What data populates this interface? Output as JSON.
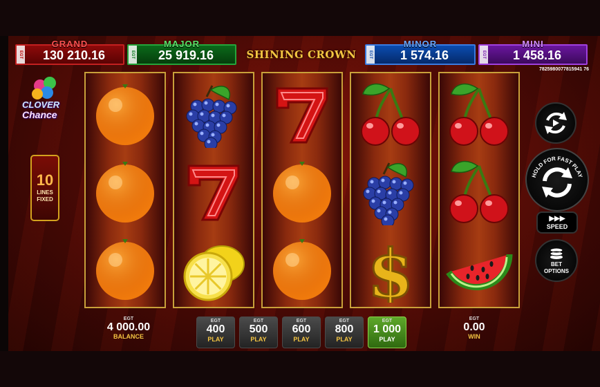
{
  "jackpots": {
    "grand": {
      "name": "GRAND",
      "value": "130 210.16"
    },
    "major": {
      "name": "MAJOR",
      "value": "25 919.16"
    },
    "minor": {
      "name": "MINOR",
      "value": "1 574.16"
    },
    "mini": {
      "name": "MINI",
      "value": "1 458.16"
    },
    "provider": "EGT"
  },
  "game_title": "SHINING CROWN",
  "ticket_id": "7825980077815941 76",
  "clover": {
    "line1": "CLOVER",
    "line2": "Chance"
  },
  "lines": {
    "count": "10",
    "line1": "LINES",
    "line2": "FIXED"
  },
  "reels": [
    [
      "orange",
      "orange",
      "orange"
    ],
    [
      "grapes",
      "seven",
      "lemon"
    ],
    [
      "seven",
      "orange",
      "orange"
    ],
    [
      "cherry",
      "grapes",
      "dollar"
    ],
    [
      "cherry",
      "cherry",
      "watermelon"
    ]
  ],
  "controls": {
    "spin_hint": "HOLD FOR FAST PLAY",
    "speed": "SPEED",
    "bet_options_line1": "BET",
    "bet_options_line2": "OPTIONS",
    "autoplay_icon": "autoplay-icon",
    "spin_icon": "spin-icon"
  },
  "balance": {
    "egt": "EGT",
    "value": "4 000.00",
    "label": "BALANCE"
  },
  "win": {
    "egt": "EGT",
    "value": "0.00",
    "label": "WIN"
  },
  "bets": [
    {
      "egt": "EGT",
      "value": "400",
      "label": "PLAY",
      "active": false
    },
    {
      "egt": "EGT",
      "value": "500",
      "label": "PLAY",
      "active": false
    },
    {
      "egt": "EGT",
      "value": "600",
      "label": "PLAY",
      "active": false
    },
    {
      "egt": "EGT",
      "value": "800",
      "label": "PLAY",
      "active": false
    },
    {
      "egt": "EGT",
      "value": "1 000",
      "label": "PLAY",
      "active": true
    }
  ],
  "colors": {
    "grand": "#c42020",
    "major": "#24a53a",
    "minor": "#3a7be0",
    "mini": "#a040e0",
    "active_bet": "#5ea82a"
  }
}
